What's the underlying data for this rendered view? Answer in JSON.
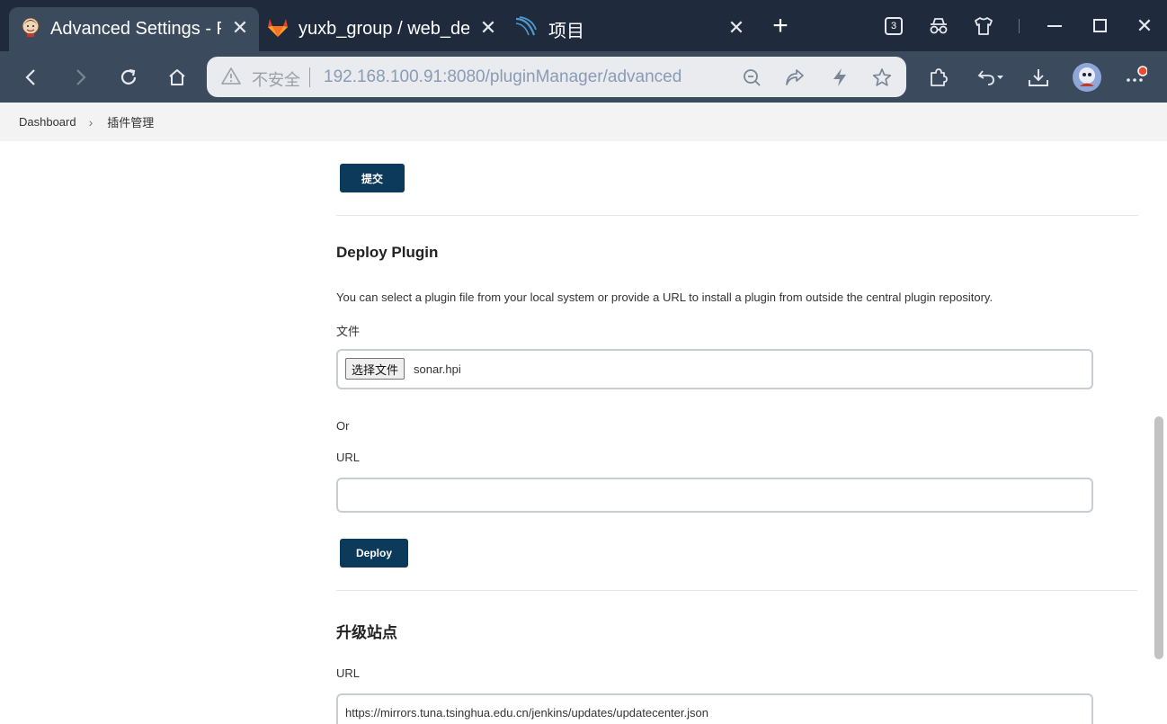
{
  "browser": {
    "tabs": [
      {
        "title": "Advanced Settings - Plugins",
        "icon": "jenkins-icon"
      },
      {
        "title": "yuxb_group / web_demo",
        "icon": "gitlab-icon"
      },
      {
        "title": "项目",
        "icon": "sonarqube-icon"
      }
    ],
    "tab_counter": "3",
    "address": {
      "security_label": "不安全",
      "url": "192.168.100.91:8080/pluginManager/advanced"
    }
  },
  "breadcrumb": {
    "items": [
      "Dashboard",
      "插件管理"
    ]
  },
  "main": {
    "submit_label": "提交",
    "deploy": {
      "heading": "Deploy Plugin",
      "description": "You can select a plugin file from your local system or provide a URL to install a plugin from outside the central plugin repository.",
      "file_label": "文件",
      "choose_file_label": "选择文件",
      "chosen_file": "sonar.hpi",
      "or_label": "Or",
      "url_label": "URL",
      "url_value": "",
      "deploy_label": "Deploy"
    },
    "update_site": {
      "heading": "升级站点",
      "url_label": "URL",
      "url_value": "https://mirrors.tuna.tsinghua.edu.cn/jenkins/updates/updatecenter.json"
    }
  },
  "colors": {
    "tabstrip_bg": "#1f2b3d",
    "toolbar_bg": "#3c4a5e",
    "primary_button": "#0b3a5b"
  }
}
